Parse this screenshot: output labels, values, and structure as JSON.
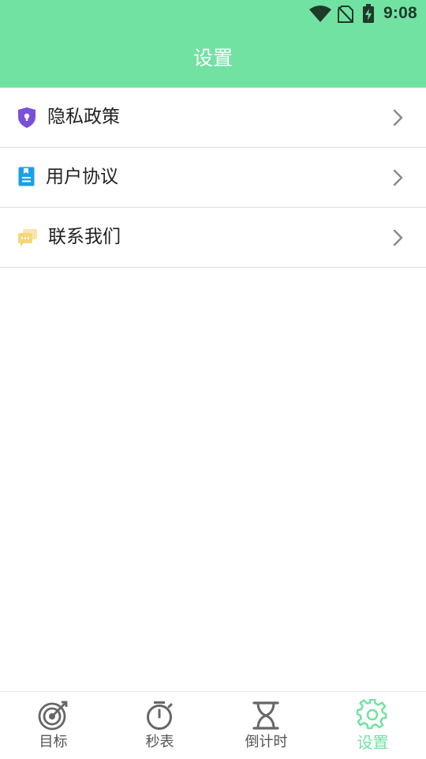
{
  "status_bar": {
    "time": "9:08"
  },
  "header": {
    "title": "设置"
  },
  "settings": {
    "items": [
      {
        "label": "隐私政策",
        "icon": "shield-lock-icon",
        "icon_color": "#7b4fd9"
      },
      {
        "label": "用户协议",
        "icon": "agreement-doc-icon",
        "icon_color": "#1aa0e8"
      },
      {
        "label": "联系我们",
        "icon": "chat-bubbles-icon",
        "icon_color": "#f3d87a"
      }
    ]
  },
  "tabbar": {
    "tabs": [
      {
        "label": "目标",
        "icon": "target-icon",
        "active": false
      },
      {
        "label": "秒表",
        "icon": "stopwatch-icon",
        "active": false
      },
      {
        "label": "倒计时",
        "icon": "hourglass-icon",
        "active": false
      },
      {
        "label": "设置",
        "icon": "gear-icon",
        "active": true
      }
    ]
  },
  "colors": {
    "accent": "#72e2a2",
    "inactive": "#555555",
    "divider": "#dcdcdc"
  }
}
